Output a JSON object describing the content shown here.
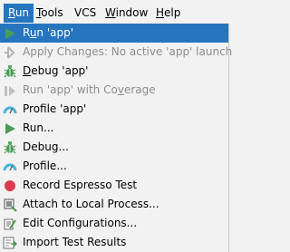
{
  "menubar": {
    "items": [
      {
        "label": "Run",
        "mnemonic": "R",
        "rest": "un",
        "active": true
      },
      {
        "label": "Tools",
        "mnemonic": "T",
        "rest": "ools",
        "active": false
      },
      {
        "label": "VCS",
        "mnemonic": "",
        "rest": "VCS",
        "active": false
      },
      {
        "label": "Window",
        "mnemonic": "W",
        "rest": "indow",
        "active": false
      },
      {
        "label": "Help",
        "mnemonic": "H",
        "rest": "elp",
        "active": false
      }
    ]
  },
  "run_menu": {
    "items": [
      {
        "label": "Run 'app'",
        "pre": "R",
        "mn": "u",
        "post": "n 'app'",
        "icon": "run-play-icon",
        "state": "highlighted"
      },
      {
        "label": "Apply Changes: No active 'app' launch",
        "pre": "",
        "mn": "",
        "post": "Apply Changes: No active 'app' launch",
        "icon": "apply-changes-icon",
        "state": "disabled"
      },
      {
        "label": "Debug 'app'",
        "pre": "",
        "mn": "D",
        "post": "ebug 'app'",
        "icon": "debug-bug-icon",
        "state": "enabled"
      },
      {
        "label": "Run 'app' with Coverage",
        "pre": "Run 'app' with Co",
        "mn": "v",
        "post": "erage",
        "icon": "coverage-icon",
        "state": "disabled"
      },
      {
        "label": "Profile 'app'",
        "pre": "",
        "mn": "",
        "post": "Profile 'app'",
        "icon": "profiler-gauge-icon",
        "state": "enabled"
      },
      {
        "label": "Run...",
        "pre": "",
        "mn": "",
        "post": "Run...",
        "icon": "run-play-icon",
        "state": "enabled"
      },
      {
        "label": "Debug...",
        "pre": "",
        "mn": "",
        "post": "Debug...",
        "icon": "debug-bug-icon",
        "state": "enabled"
      },
      {
        "label": "Profile...",
        "pre": "",
        "mn": "",
        "post": "Profile...",
        "icon": "profiler-gauge-icon",
        "state": "enabled"
      },
      {
        "label": "Record Espresso Test",
        "pre": "",
        "mn": "",
        "post": "Record Espresso Test",
        "icon": "record-icon",
        "state": "enabled"
      },
      {
        "label": "Attach to Local Process...",
        "pre": "",
        "mn": "",
        "post": "Attach to Local Process...",
        "icon": "attach-process-icon",
        "state": "enabled"
      },
      {
        "label": "Edit Configurations...",
        "pre": "",
        "mn": "",
        "post": "Edit Configurations...",
        "icon": "edit-configurations-icon",
        "state": "enabled"
      },
      {
        "label": "Import Test Results",
        "pre": "",
        "mn": "",
        "post": "Import Test Results",
        "icon": "import-results-icon",
        "state": "enabled"
      }
    ]
  },
  "colors": {
    "highlight": "#2675bf",
    "menu_background": "#f2f2f2",
    "disabled_text": "#8c8c8c",
    "play_green": "#499c54",
    "record_red": "#db3b4b",
    "gauge_blue": "#40b6e0"
  }
}
